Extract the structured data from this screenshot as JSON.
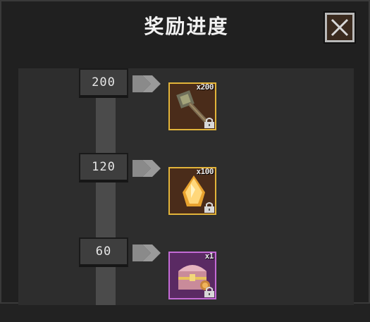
{
  "header": {
    "title": "奖励进度",
    "close_icon": "close-x-icon"
  },
  "milestones": [
    {
      "value": "200",
      "reward": {
        "icon": "hammer-icon",
        "quantity": "x200",
        "rarity_color": "#e2b43a",
        "locked": true
      }
    },
    {
      "value": "120",
      "reward": {
        "icon": "gem-crystal-icon",
        "quantity": "x100",
        "rarity_color": "#e2b43a",
        "locked": true
      }
    },
    {
      "value": "60",
      "reward": {
        "icon": "treasure-chest-icon",
        "quantity": "x1",
        "rarity_color": "#c46bd6",
        "locked": true
      }
    }
  ],
  "colors": {
    "background": "#202020",
    "content": "#2d2d2d",
    "track": "#4b4b4b",
    "gold_border": "#e2b43a",
    "purple_border": "#c46bd6"
  }
}
